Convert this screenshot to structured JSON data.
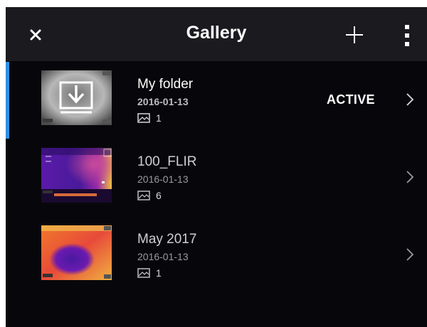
{
  "header": {
    "title": "Gallery",
    "close_icon": "close-icon",
    "add_icon": "plus-icon",
    "more_icon": "more-vertical-icon",
    "background": "#1b1b1f"
  },
  "folders": [
    {
      "name": "My folder",
      "date": "2016-01-13",
      "count": "1",
      "status": "ACTIVE",
      "thumbnail": "download-folder-icon"
    },
    {
      "name": "100_FLIR",
      "date": "2016-01-13",
      "count": "6",
      "thumbnail": "thermal-image"
    },
    {
      "name": "May 2017",
      "date": "2016-01-13",
      "count": "1",
      "thumbnail": "thermal-image"
    }
  ],
  "colors": {
    "accent": "#2f8fe3",
    "background": "#07070b"
  }
}
